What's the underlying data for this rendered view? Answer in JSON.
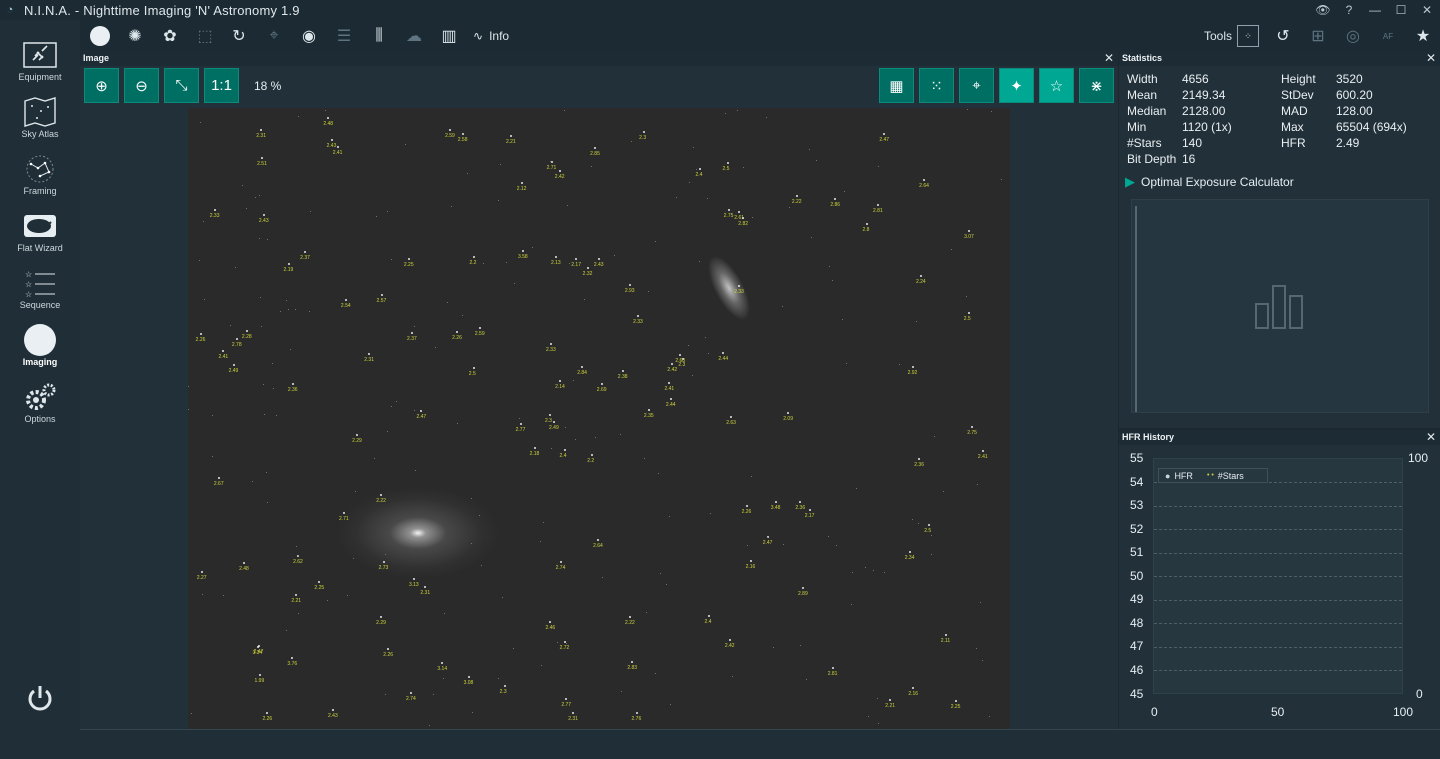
{
  "window": {
    "title": "N.I.N.A. - Nighttime Imaging 'N' Astronomy 1.9",
    "buttons": [
      "eye-icon",
      "help-icon",
      "minimize",
      "maximize",
      "close"
    ]
  },
  "sidebar": {
    "items": [
      {
        "label": "Equipment",
        "icon": "plug-icon"
      },
      {
        "label": "Sky Atlas",
        "icon": "map-icon"
      },
      {
        "label": "Framing",
        "icon": "constellation-icon"
      },
      {
        "label": "Flat Wizard",
        "icon": "flat-wizard-icon"
      },
      {
        "label": "Sequence",
        "icon": "list-icon"
      },
      {
        "label": "Imaging",
        "icon": "camera-icon",
        "active": true
      },
      {
        "label": "Options",
        "icon": "gear-icon"
      }
    ]
  },
  "toolbar": {
    "info_label": "Info",
    "tools_label": "Tools"
  },
  "image_panel": {
    "title": "Image",
    "zoom_level": "18 %",
    "one_to_one": "1:1"
  },
  "statistics": {
    "title": "Statistics",
    "rows": [
      {
        "k1": "Width",
        "v1": "4656",
        "k2": "Height",
        "v2": "3520"
      },
      {
        "k1": "Mean",
        "v1": "2149.34",
        "k2": "StDev",
        "v2": "600.20"
      },
      {
        "k1": "Median",
        "v1": "2128.00",
        "k2": "MAD",
        "v2": "128.00"
      },
      {
        "k1": "Min",
        "v1": "1120 (1x)",
        "k2": "Max",
        "v2": "65504 (694x)"
      },
      {
        "k1": "#Stars",
        "v1": "140",
        "k2": "HFR",
        "v2": "2.49"
      },
      {
        "k1": "Bit Depth",
        "v1": "16",
        "k2": "",
        "v2": ""
      }
    ],
    "exposure_calc": "Optimal Exposure Calculator"
  },
  "hfr_history": {
    "title": "HFR History",
    "legend": [
      "HFR",
      "#Stars"
    ],
    "left_ticks": [
      "55",
      "54",
      "53",
      "52",
      "51",
      "50",
      "49",
      "48",
      "47",
      "46",
      "45"
    ],
    "right_top": "100",
    "right_bottom": "0",
    "x_ticks": [
      "0",
      "50",
      "100"
    ]
  },
  "star_labels": [
    "2.2",
    "2.19",
    "2.49",
    "2.47",
    "2.42",
    "2.31",
    "2.5",
    "2.43",
    "2.61",
    "2.35",
    "2.41",
    "2.25",
    "2.36",
    "3.07",
    "2.18",
    "2.33",
    "2.43",
    "2.13",
    "2.33",
    "2.25",
    "2.59",
    "1.99",
    "2.26",
    "2.17",
    "2.3",
    "2.17",
    "2.37",
    "2.42",
    "2.49",
    "2.26",
    "2.5",
    "2.3",
    "2.46",
    "2.14",
    "2.25",
    "2.22",
    "3.13",
    "2.21",
    "2.11",
    "2.36",
    "2.3",
    "2.26",
    "2.31",
    "2.16",
    "2.74",
    "2.26",
    "2.41",
    "2.26",
    "2.72",
    "2.44",
    "2.21",
    "2.24",
    "2.33",
    "2.47",
    "2.42",
    "2.29",
    "2.43",
    "2.31",
    "2.22",
    "2.81",
    "2.85",
    "2.47",
    "2.28",
    "2.57",
    "2.86",
    "2.48",
    "2.4",
    "2.12",
    "2.84",
    "2.27",
    "2.74",
    "3.08",
    "3.48",
    "2.37",
    "3.34",
    "2.51",
    "2.54",
    "2.67",
    "2.33",
    "2.83",
    "2.38",
    "3.76",
    "2.63",
    "2.5",
    "2.77",
    "2.92",
    "2.64",
    "2.81",
    "2.76",
    "2.4",
    "2.71",
    "2.41",
    "2.44",
    "2.89",
    "2.69",
    "2.34",
    "2.78",
    "2.31",
    "2.75",
    "2.82",
    "2.29",
    "2.59",
    "2.75",
    "2.41",
    "2.71",
    "2.73",
    "3.14",
    "2.68",
    "2.8",
    "2.5",
    "2.36",
    "2.43",
    "2.32",
    "2.77",
    "2.58",
    "2.48",
    "2.4",
    "2.64",
    "3.58",
    "2.21",
    "2.62",
    "2.47",
    "2.93",
    "2.2",
    "2.09",
    "2.22",
    "2.16",
    "2.3"
  ]
}
